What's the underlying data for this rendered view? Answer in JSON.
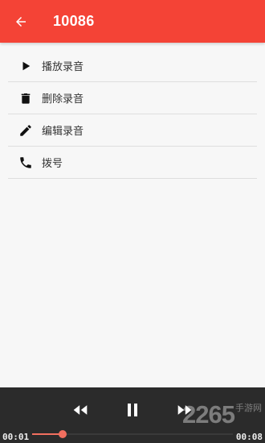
{
  "appbar": {
    "title": "10086",
    "back_icon": "arrow-left-icon",
    "color": "#f44336"
  },
  "menu": {
    "items": [
      {
        "label": "播放录音",
        "icon": "play-icon"
      },
      {
        "label": "删除录音",
        "icon": "trash-icon"
      },
      {
        "label": "编辑录音",
        "icon": "pencil-icon"
      },
      {
        "label": "拨号",
        "icon": "phone-icon"
      }
    ]
  },
  "player": {
    "current_time": "00:01",
    "total_time": "00:08",
    "progress": 0.15,
    "controls": [
      "rewind-icon",
      "pause-icon",
      "fast-forward-icon"
    ],
    "accent": "#f26f5f"
  },
  "watermark": {
    "number": "2265",
    "text": "手游网"
  }
}
